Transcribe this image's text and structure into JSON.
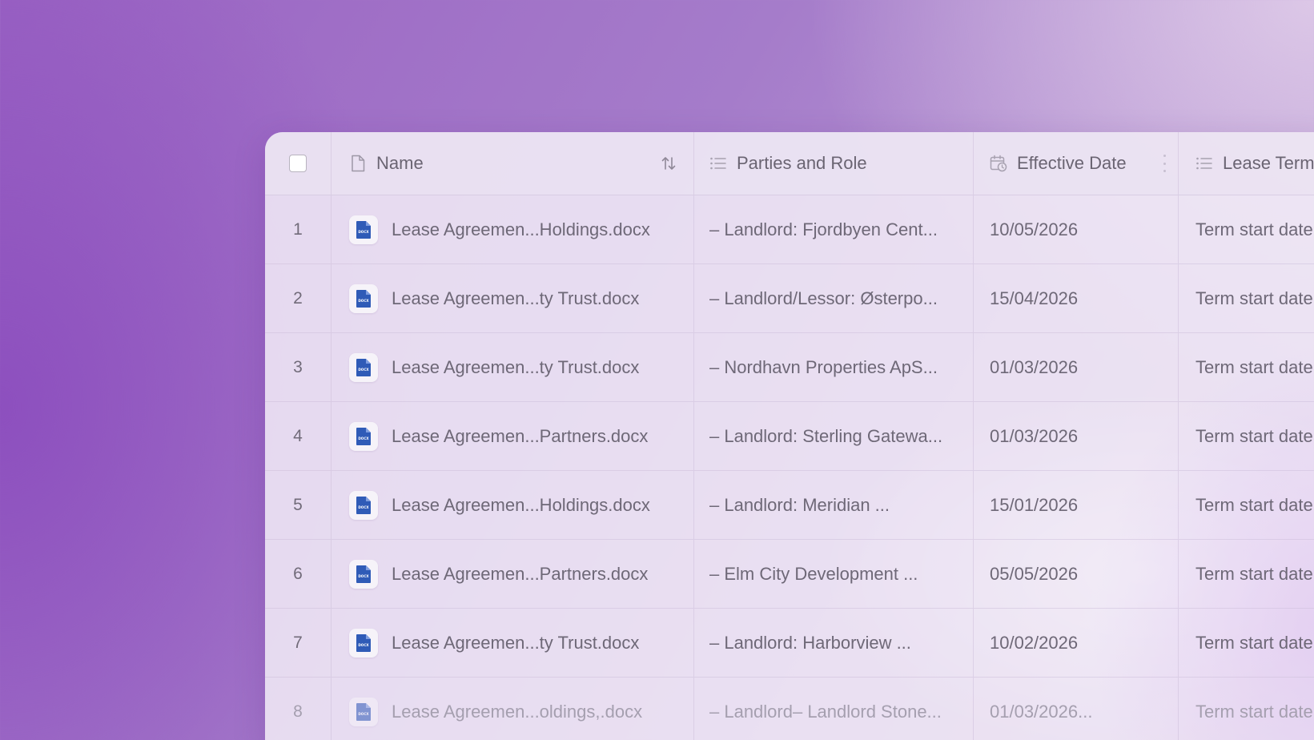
{
  "table": {
    "columns": [
      {
        "label": "Name",
        "icon": "file-icon"
      },
      {
        "label": "Parties and Role",
        "icon": "list-icon"
      },
      {
        "label": "Effective Date",
        "icon": "calendar-clock-icon"
      },
      {
        "label": "Lease Term",
        "icon": "list-icon"
      }
    ],
    "file_badge": "DOCX",
    "rows": [
      {
        "num": "1",
        "name": "Lease Agreemen...Holdings.docx",
        "parties": "– Landlord: Fjordbyen Cent...",
        "date": "10/05/2026",
        "term": "Term start date"
      },
      {
        "num": "2",
        "name": "Lease Agreemen...ty Trust.docx",
        "parties": "– Landlord/Lessor: Østerpo...",
        "date": "15/04/2026",
        "term": "Term start date"
      },
      {
        "num": "3",
        "name": "Lease Agreemen...ty Trust.docx",
        "parties": "– Nordhavn Properties ApS...",
        "date": "01/03/2026",
        "term": "Term start date"
      },
      {
        "num": "4",
        "name": "Lease Agreemen...Partners.docx",
        "parties": "– Landlord: Sterling Gatewa...",
        "date": "01/03/2026",
        "term": "Term start date"
      },
      {
        "num": "5",
        "name": "Lease Agreemen...Holdings.docx",
        "parties": "– Landlord: Meridian ...",
        "date": "15/01/2026",
        "term": "Term start date"
      },
      {
        "num": "6",
        "name": "Lease Agreemen...Partners.docx",
        "parties": "– Elm City Development ...",
        "date": "05/05/2026",
        "term": "Term start date"
      },
      {
        "num": "7",
        "name": "Lease Agreemen...ty Trust.docx",
        "parties": "– Landlord: Harborview ...",
        "date": "10/02/2026",
        "term": "Term start date"
      },
      {
        "num": "8",
        "name": "Lease Agreemen...oldings,.docx",
        "parties": "– Landlord– Landlord Stone...",
        "date": "01/03/2026...",
        "term": "Term start date"
      }
    ]
  },
  "colors": {
    "docx_blue": "#2f5bb7",
    "background_purple": "#9a63c3"
  }
}
